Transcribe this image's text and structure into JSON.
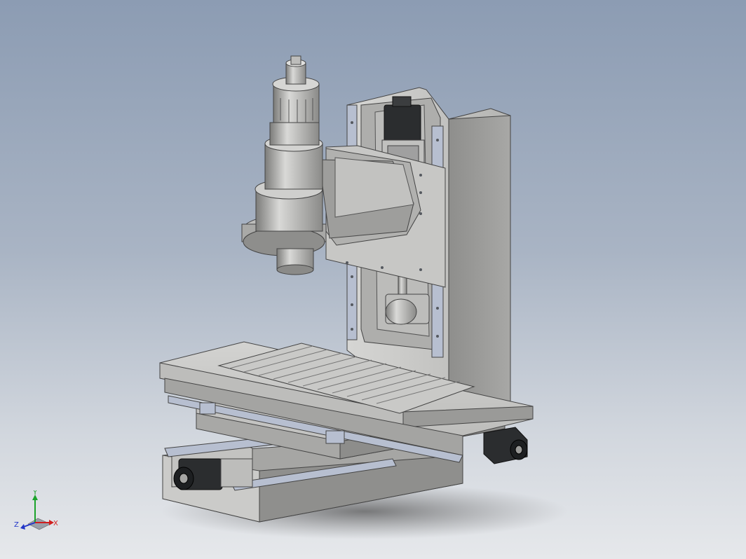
{
  "viewport": {
    "background_top": "#8c9cb3",
    "background_bottom": "#e6e8eb"
  },
  "model": {
    "part_color": "#c9c9c7",
    "shade_color": "#9d9d9b",
    "dark_color": "#6f6f6d",
    "motor_color": "#2b2d2f",
    "rail_color": "#b7bfd0"
  },
  "triad": {
    "x_label": "X",
    "y_label": "Y",
    "z_label": "Z",
    "x_color": "#d11f1f",
    "y_color": "#1aa32a",
    "z_color": "#2236c8"
  }
}
